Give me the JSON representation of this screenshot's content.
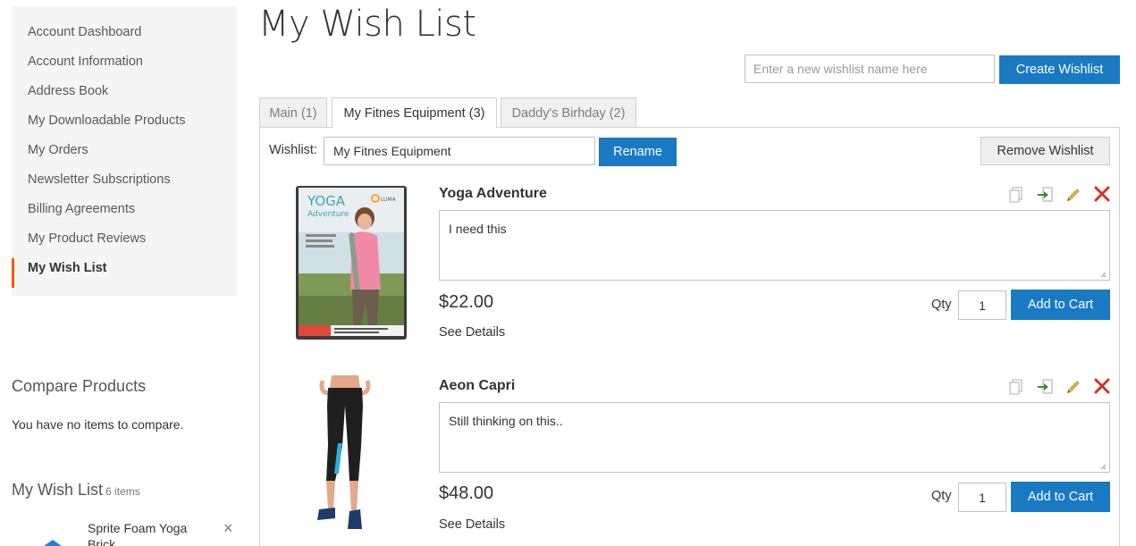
{
  "sidebar": {
    "items": [
      {
        "label": "Account Dashboard"
      },
      {
        "label": "Account Information"
      },
      {
        "label": "Address Book"
      },
      {
        "label": "My Downloadable Products"
      },
      {
        "label": "My Orders"
      },
      {
        "label": "Newsletter Subscriptions"
      },
      {
        "label": "Billing Agreements"
      },
      {
        "label": "My Product Reviews"
      },
      {
        "label": "My Wish List",
        "active": true
      }
    ],
    "compare": {
      "title": "Compare Products",
      "empty_text": "You have no items to compare."
    },
    "wishlist_block": {
      "title": "My Wish List",
      "count": "6 items",
      "first_item": "Sprite Foam Yoga Brick"
    }
  },
  "page": {
    "title": "My Wish List"
  },
  "create": {
    "placeholder": "Enter a new wishlist name here",
    "button_label": "Create Wishlist"
  },
  "tabs": [
    {
      "label": "Main (1)"
    },
    {
      "label": "My Fitnes Equipment (3)",
      "active": true
    },
    {
      "label": "Daddy's Birhday (2)"
    }
  ],
  "wishlist": {
    "label": "Wishlist:",
    "name_value": "My Fitnes Equipment",
    "rename_label": "Rename",
    "remove_label": "Remove Wishlist"
  },
  "products": [
    {
      "name": "Yoga Adventure",
      "comment": "I need this",
      "price": "$22.00",
      "details_label": "See Details",
      "qty_label": "Qty",
      "qty": "1",
      "add_label": "Add to Cart",
      "image_text": {
        "title": "YOGA",
        "subtitle": "Adventure",
        "brand": "LUMA"
      }
    },
    {
      "name": "Aeon Capri",
      "comment": "Still thinking on this..",
      "price": "$48.00",
      "details_label": "See Details",
      "qty_label": "Qty",
      "qty": "1",
      "add_label": "Add to Cart"
    }
  ],
  "colors": {
    "primary": "#1979c3",
    "active_marker": "#ff5501",
    "remove": "#d0332c",
    "edit": "#e8b54a",
    "move": "#3d8b37"
  },
  "icons": [
    "copy-icon",
    "move-icon",
    "edit-icon",
    "remove-icon",
    "close-icon"
  ]
}
